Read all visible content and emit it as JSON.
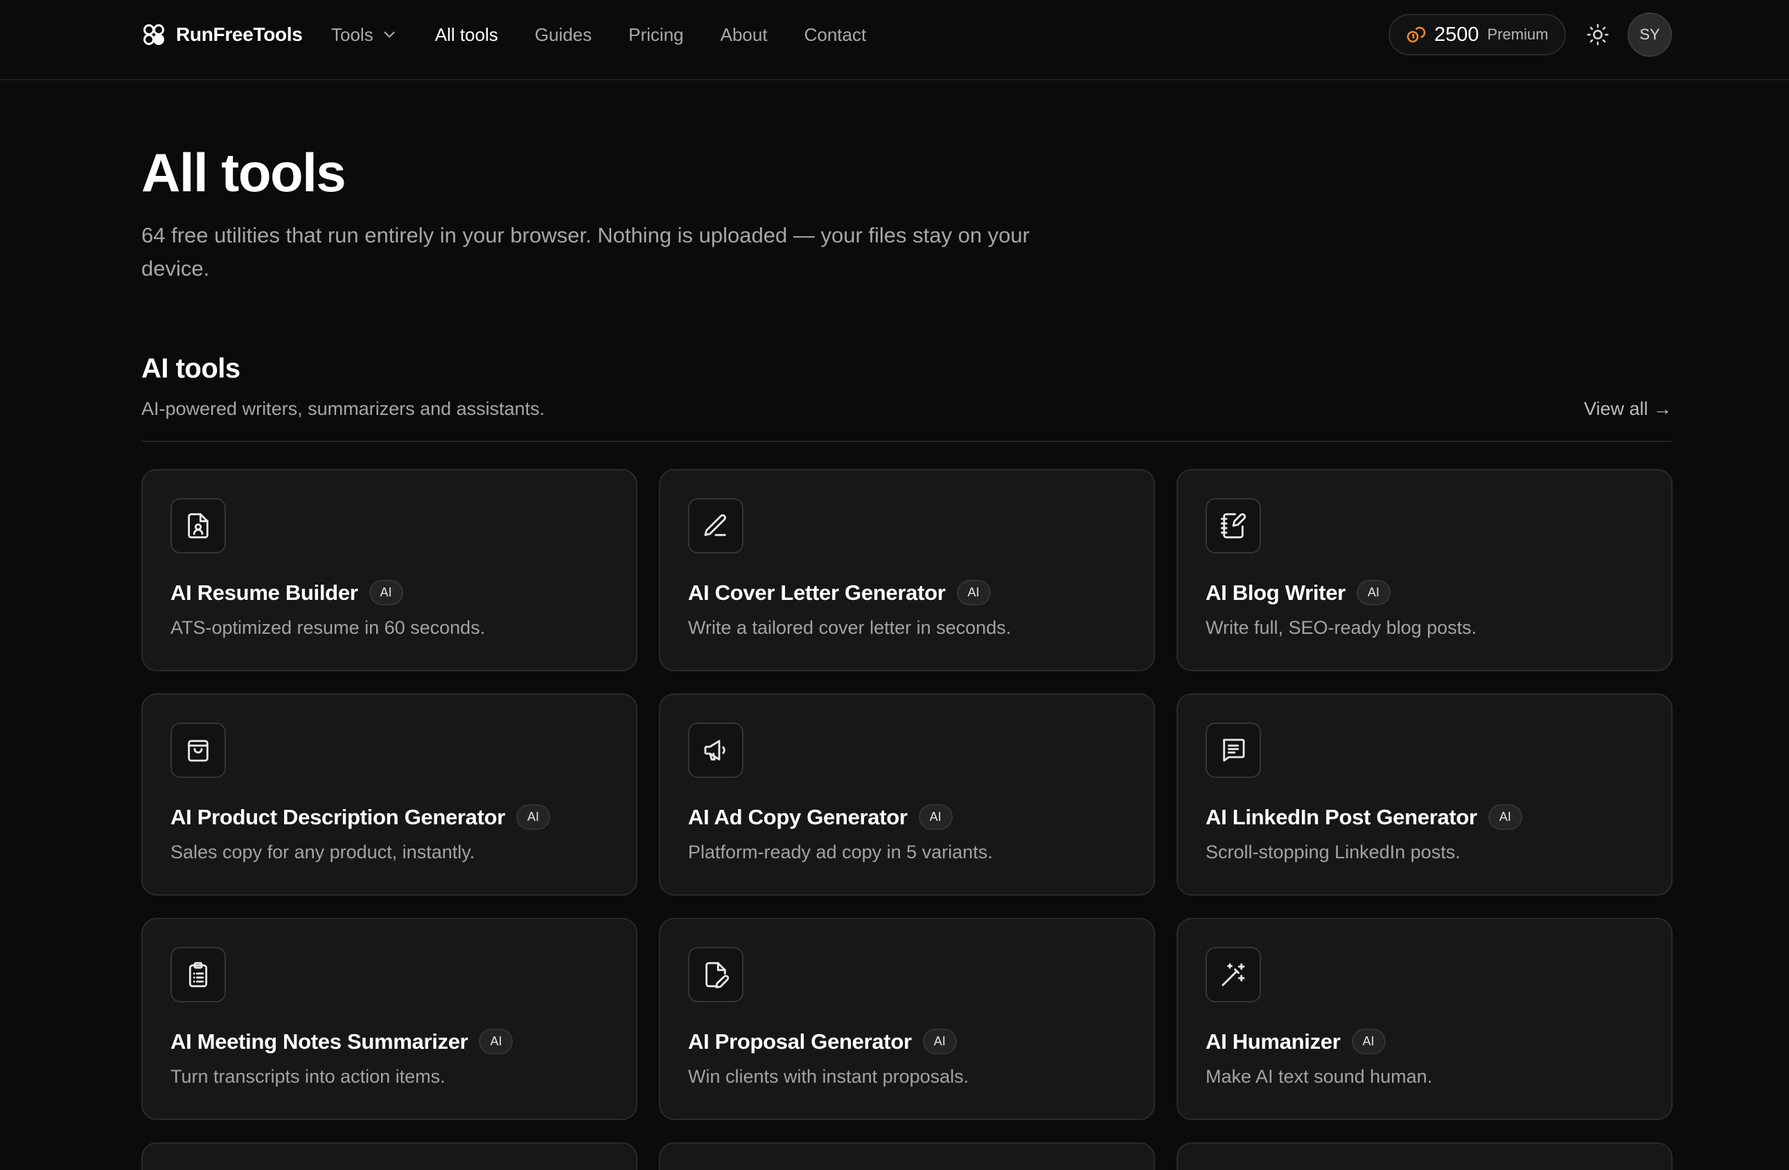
{
  "brand": {
    "name": "RunFreeTools"
  },
  "nav": {
    "tools": "Tools",
    "all_tools": "All tools",
    "guides": "Guides",
    "pricing": "Pricing",
    "about": "About",
    "contact": "Contact"
  },
  "account": {
    "credits": "2500",
    "plan": "Premium",
    "initials": "SY"
  },
  "hero": {
    "title": "All tools",
    "subtitle": "64 free utilities that run entirely in your browser. Nothing is uploaded — your files stay on your device."
  },
  "section": {
    "title": "AI tools",
    "subtitle": "AI-powered writers, summarizers and assistants.",
    "view_all": "View all →"
  },
  "cards": [
    {
      "title": "AI Resume Builder",
      "badge": "AI",
      "desc": "ATS-optimized resume in 60 seconds.",
      "icon": "resume-icon"
    },
    {
      "title": "AI Cover Letter Generator",
      "badge": "AI",
      "desc": "Write a tailored cover letter in seconds.",
      "icon": "pen-icon"
    },
    {
      "title": "AI Blog Writer",
      "badge": "AI",
      "desc": "Write full, SEO-ready blog posts.",
      "icon": "notebook-pen-icon"
    },
    {
      "title": "AI Product Description Generator",
      "badge": "AI",
      "desc": "Sales copy for any product, instantly.",
      "icon": "shopping-bag-icon"
    },
    {
      "title": "AI Ad Copy Generator",
      "badge": "AI",
      "desc": "Platform-ready ad copy in 5 variants.",
      "icon": "megaphone-icon"
    },
    {
      "title": "AI LinkedIn Post Generator",
      "badge": "AI",
      "desc": "Scroll-stopping LinkedIn posts.",
      "icon": "message-lines-icon"
    },
    {
      "title": "AI Meeting Notes Summarizer",
      "badge": "AI",
      "desc": "Turn transcripts into action items.",
      "icon": "clipboard-list-icon"
    },
    {
      "title": "AI Proposal Generator",
      "badge": "AI",
      "desc": "Win clients with instant proposals.",
      "icon": "file-pen-icon"
    },
    {
      "title": "AI Humanizer",
      "badge": "AI",
      "desc": "Make AI text sound human.",
      "icon": "magic-wand-icon"
    }
  ],
  "colors": {
    "background": "#0b0b0b",
    "card": "#171717",
    "accent_credits": "#f08a24"
  }
}
